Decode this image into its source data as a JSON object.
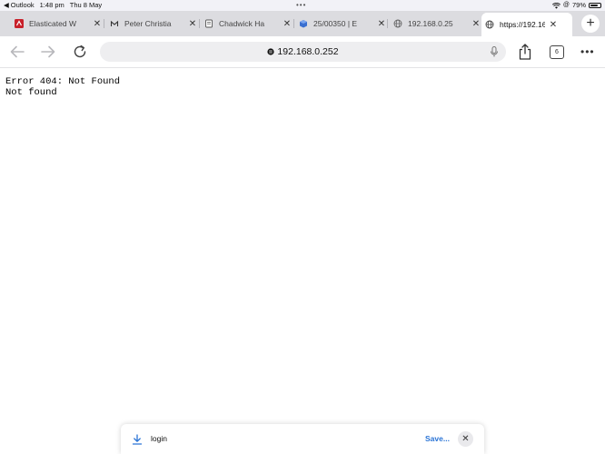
{
  "status_bar": {
    "back_app": "Outlook",
    "time": "1:48 pm",
    "date": "Thu 8 May",
    "battery_percent": "79%",
    "battery_level": 0.79,
    "multitasking_dots": "•••"
  },
  "tabs": [
    {
      "title": "Elasticated W",
      "icon": "elasticated-logo-icon",
      "active": false
    },
    {
      "title": "Peter Christia",
      "icon": "crown-logo-icon",
      "active": false
    },
    {
      "title": "Chadwick Ha",
      "icon": "document-icon",
      "active": false
    },
    {
      "title": "25/00350 | E",
      "icon": "cube-logo-icon",
      "active": false
    },
    {
      "title": "192.168.0.25",
      "icon": "globe-icon",
      "active": false
    },
    {
      "title": "https://192.16",
      "icon": "globe-icon",
      "active": true
    }
  ],
  "new_tab_label": "+",
  "toolbar": {
    "url": "192.168.0.252",
    "tab_count": "6",
    "more_label": "•••"
  },
  "page": {
    "line1": "Error 404: Not Found",
    "line2": "Not found"
  },
  "download": {
    "filename": "login",
    "save_label": "Save...",
    "close_label": "✕"
  },
  "colors": {
    "accent": "#2a74d6",
    "tab_strip": "#dcdce0",
    "address_bar": "#eeeef0"
  }
}
